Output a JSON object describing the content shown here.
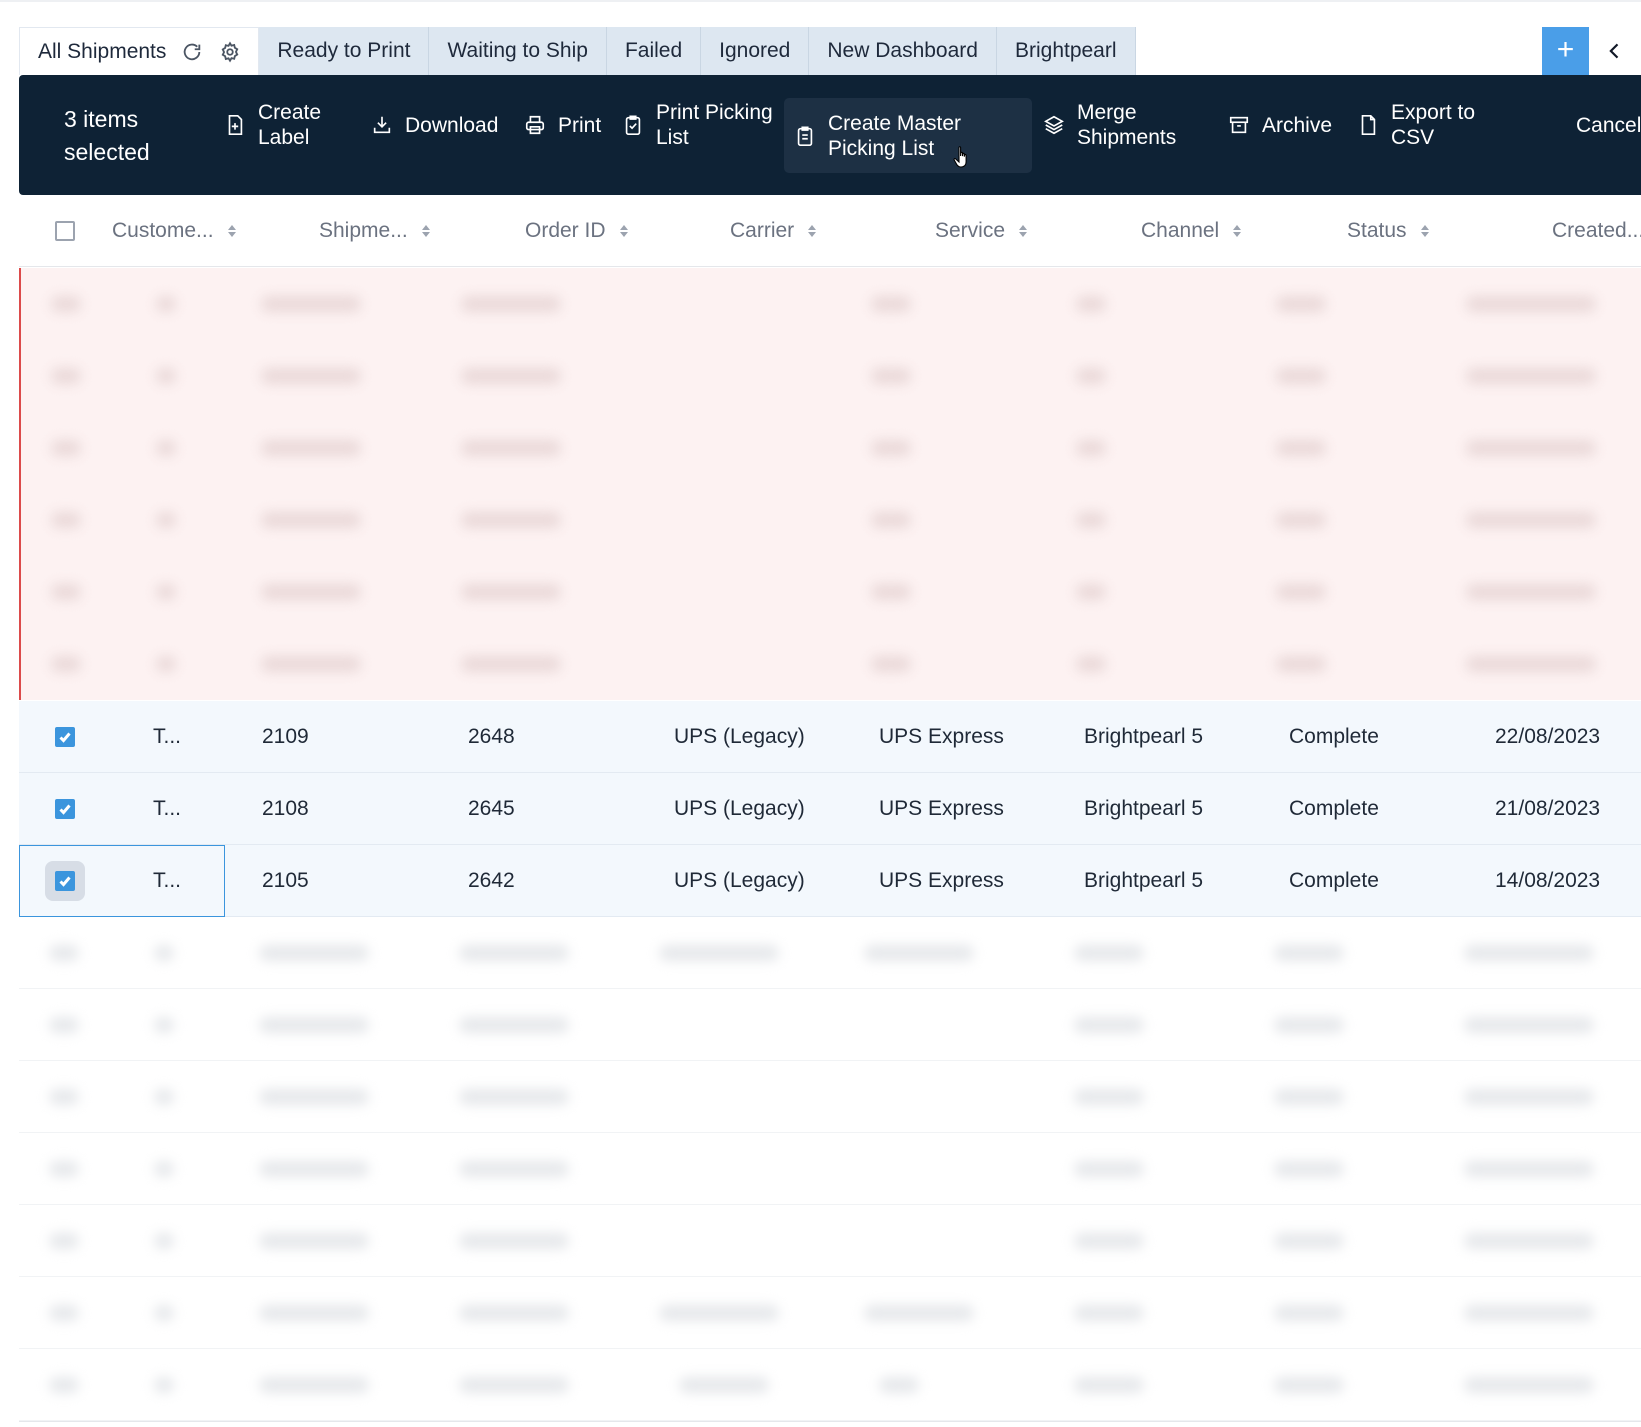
{
  "tabs": [
    {
      "label": "All Shipments",
      "active": true
    },
    {
      "label": "Ready to Print"
    },
    {
      "label": "Waiting to Ship"
    },
    {
      "label": "Failed"
    },
    {
      "label": "Ignored"
    },
    {
      "label": "New Dashboard"
    },
    {
      "label": "Brightpearl"
    }
  ],
  "tab_icons": {
    "refresh": "refresh-icon",
    "settings": "gear-icon"
  },
  "add_label": "+",
  "actionbar": {
    "selected_count": "3 items selected",
    "actions": {
      "create_label": "Create Label",
      "download": "Download",
      "print": "Print",
      "print_picking_list": "Print Picking List",
      "create_master_picking_list": "Create Master Picking List",
      "merge_shipments": "Merge Shipments",
      "archive": "Archive",
      "export_csv": "Export to CSV",
      "cancel": "Cancel"
    }
  },
  "table": {
    "columns": {
      "customer": "Custome...",
      "shipment": "Shipme...",
      "order_id": "Order ID",
      "carrier": "Carrier",
      "service": "Service",
      "channel": "Channel",
      "status": "Status",
      "created": "Created..."
    },
    "rows": [
      {
        "customer": "T...",
        "shipment": "2109",
        "order_id": "2648",
        "carrier": "UPS (Legacy)",
        "service": "UPS Express",
        "channel": "Brightpearl 5",
        "status": "Complete",
        "created": "22/08/2023",
        "checked": true
      },
      {
        "customer": "T...",
        "shipment": "2108",
        "order_id": "2645",
        "carrier": "UPS (Legacy)",
        "service": "UPS Express",
        "channel": "Brightpearl 5",
        "status": "Complete",
        "created": "21/08/2023",
        "checked": true
      },
      {
        "customer": "T...",
        "shipment": "2105",
        "order_id": "2642",
        "carrier": "UPS (Legacy)",
        "service": "UPS Express",
        "channel": "Brightpearl 5",
        "status": "Complete",
        "created": "14/08/2023",
        "checked": true
      }
    ]
  },
  "colors": {
    "accent": "#4a9ee8",
    "actionbar_bg": "#0e2235",
    "tab_bg": "#dde7f1",
    "failed_band": "#fdf2f2",
    "selected_row": "#f3f8fd"
  }
}
